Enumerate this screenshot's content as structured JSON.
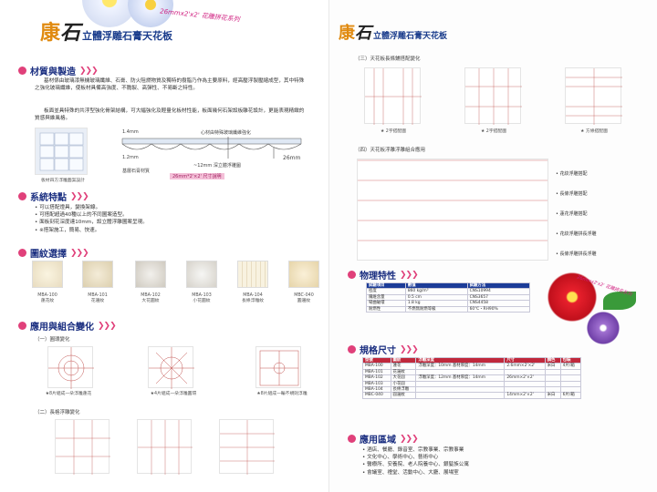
{
  "left": {
    "banner": "26mmx2'x2' 花雕拼花系列",
    "brand": {
      "kang": "康",
      "shi": "石",
      "name": "立體浮雕石膏天花板"
    },
    "s1": {
      "title": "材質與製造",
      "p1": "基材係由玻璃漆無機玻璃纖維、石膏、防火阻燃物質及獨特的樹脂乃作為主要原料，經高壓浮製壓縮成型，其中特殊之強化玻璃纖維，使板材具備高強度、不脆裂、高彈性、不易斷之特性。",
      "p2": "板面並具特殊的共浮型強化骨架結構，可大幅強化及輕量化板材性能，板面幾何石架設板雕花設計，更能表現精緻的質感與維風格。",
      "caption": "板材四方浮雕圖案設計",
      "lbl_14": "1.4mm",
      "lbl_12": "1.2mm",
      "lbl_26": "26mm",
      "lbl_core": "心材由特殊玻璃纖維強化",
      "lbl_base": "基層石膏材質",
      "lbl_deep": "~12mm 深立體浮雕圖",
      "lbl_badge": "26mm*2'×2' 尺寸說明"
    },
    "s2": {
      "title": "系統特點",
      "items": [
        "可以搭配燈具，變換架線。",
        "可搭配超過40種以上的不同圖案造型。",
        "面板刻花深度達10mm，設立體浮雕圖案呈現。",
        "※搭架施工，簡易、快速。"
      ]
    },
    "s3": {
      "title": "圖紋選擇",
      "items": [
        {
          "code": "MBA-100",
          "name": "蓮花紋"
        },
        {
          "code": "MBA-101",
          "name": "花邊紋"
        },
        {
          "code": "MBA-102",
          "name": "大花圓紋"
        },
        {
          "code": "MBA-103",
          "name": "小花圓紋"
        },
        {
          "code": "MBA-104",
          "name": "長條浮雕紋"
        },
        {
          "code": "MBC-040",
          "name": "圓邊紋"
        }
      ]
    },
    "s4": {
      "title": "應用與組合變化",
      "sub1": "（一）圓環變化",
      "caps1": [
        "★8片組成一朵浮雕蓮花",
        "★4片組成一朵浮雕圓環",
        "★8片組成一輪不規則浮雕"
      ],
      "sub2": "（二）長格浮雕變化"
    }
  },
  "right": {
    "brand": {
      "kang": "康",
      "shi": "石",
      "name": "立體浮雕石膏天花板"
    },
    "sub3": "（三）天花板長條鋪搭配變化",
    "caps3": [
      "★ 2字搭配圖",
      "★ 2字搭配圖",
      "★ 方條搭配圖"
    ],
    "sub4": "（四）天花板浮雕浮雕組合應用",
    "stars4": [
      "花紋浮雕搭配",
      "長條浮雕搭配",
      "蓮花浮雕搭配",
      "花紋浮雕拼長浮雕",
      "長條浮雕拼長浮雕"
    ],
    "phys": {
      "title": "物理特性",
      "headers": [
        "試驗項目",
        "數值",
        "試驗方法"
      ],
      "rows": [
        [
          "密度",
          "860 kg/m³",
          "CNS10994"
        ],
        [
          "纖維含量",
          "0.5 cm",
          "CNS3657"
        ],
        [
          "彎曲破壞",
          "1.8 kg",
          "CNS4458"
        ],
        [
          "耐燃性",
          "不燃無耐燃等級",
          "60℃・RH90%"
        ]
      ]
    },
    "spec": {
      "title": "規格尺寸",
      "headers": [
        "型號",
        "圖紋",
        "浮雕深度",
        "尺寸",
        "顏色",
        "包裝"
      ],
      "rows": [
        [
          "MBA-100",
          "蓮花",
          "浮雕深度：10mm 基材厚度：14mm",
          "2.6mm×2'×2'",
          "米白",
          "4片/箱"
        ],
        [
          "MBA-101",
          "花邊紋",
          "",
          "",
          "",
          ""
        ],
        [
          "MBA-102",
          "大花圓",
          "浮雕深度：12mm 基材厚度：14mm",
          "26mm×2'×2'",
          "",
          ""
        ],
        [
          "MBA-103",
          "小花圓",
          "",
          "",
          "",
          ""
        ],
        [
          "MBA-104",
          "長條浮雕",
          "",
          "",
          "",
          ""
        ],
        [
          "MBC-040",
          "圓邊紋",
          "",
          "14mm×2'×2'",
          "米白",
          "6片/箱"
        ]
      ]
    },
    "apps": {
      "title": "應用區域",
      "items": [
        "酒店、餐廳、錄音室、宗教事業、宗教事業",
        "文化中心、學術中心、藝術中心",
        "醫療所、安養院、老人院養中心、銀髮族公寓",
        "會議室、禮堂、活動中心、大廳、展場室"
      ]
    },
    "flower_banner": "26mmx2'x2' 花雕拼花系列"
  }
}
